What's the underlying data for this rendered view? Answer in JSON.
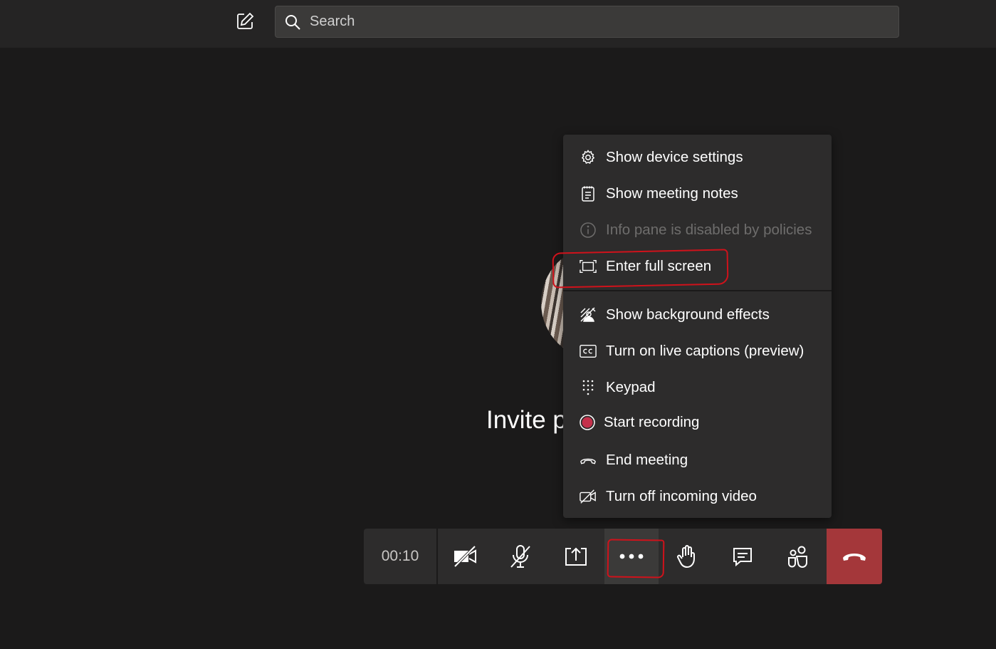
{
  "search": {
    "placeholder": "Search"
  },
  "stage": {
    "invite_text": "Invite p"
  },
  "menu": {
    "items": [
      {
        "label": "Show device settings",
        "icon": "gear-icon"
      },
      {
        "label": "Show meeting notes",
        "icon": "notes-icon"
      },
      {
        "label": "Info pane is disabled by policies",
        "icon": "info-icon",
        "disabled": true
      },
      {
        "label": "Enter full screen",
        "icon": "fullscreen-icon"
      },
      {
        "label": "Show background effects",
        "icon": "background-effects-icon"
      },
      {
        "label": "Turn on live captions (preview)",
        "icon": "captions-icon"
      },
      {
        "label": "Keypad",
        "icon": "keypad-icon"
      },
      {
        "label": "Start recording",
        "icon": "record-icon"
      },
      {
        "label": "End meeting",
        "icon": "end-meeting-icon"
      },
      {
        "label": "Turn off incoming video",
        "icon": "incoming-video-off-icon"
      }
    ]
  },
  "toolbar": {
    "timer": "00:10",
    "buttons": [
      "camera-off-icon",
      "mic-off-icon",
      "share-screen-icon",
      "more-options-icon",
      "raise-hand-icon",
      "chat-icon",
      "participants-icon",
      "hangup-icon"
    ]
  },
  "colors": {
    "background": "#1b1a1a",
    "menu": "#2d2c2c",
    "hangup": "#a4373a",
    "annotation": "#d0121b",
    "record": "#c4314b"
  }
}
